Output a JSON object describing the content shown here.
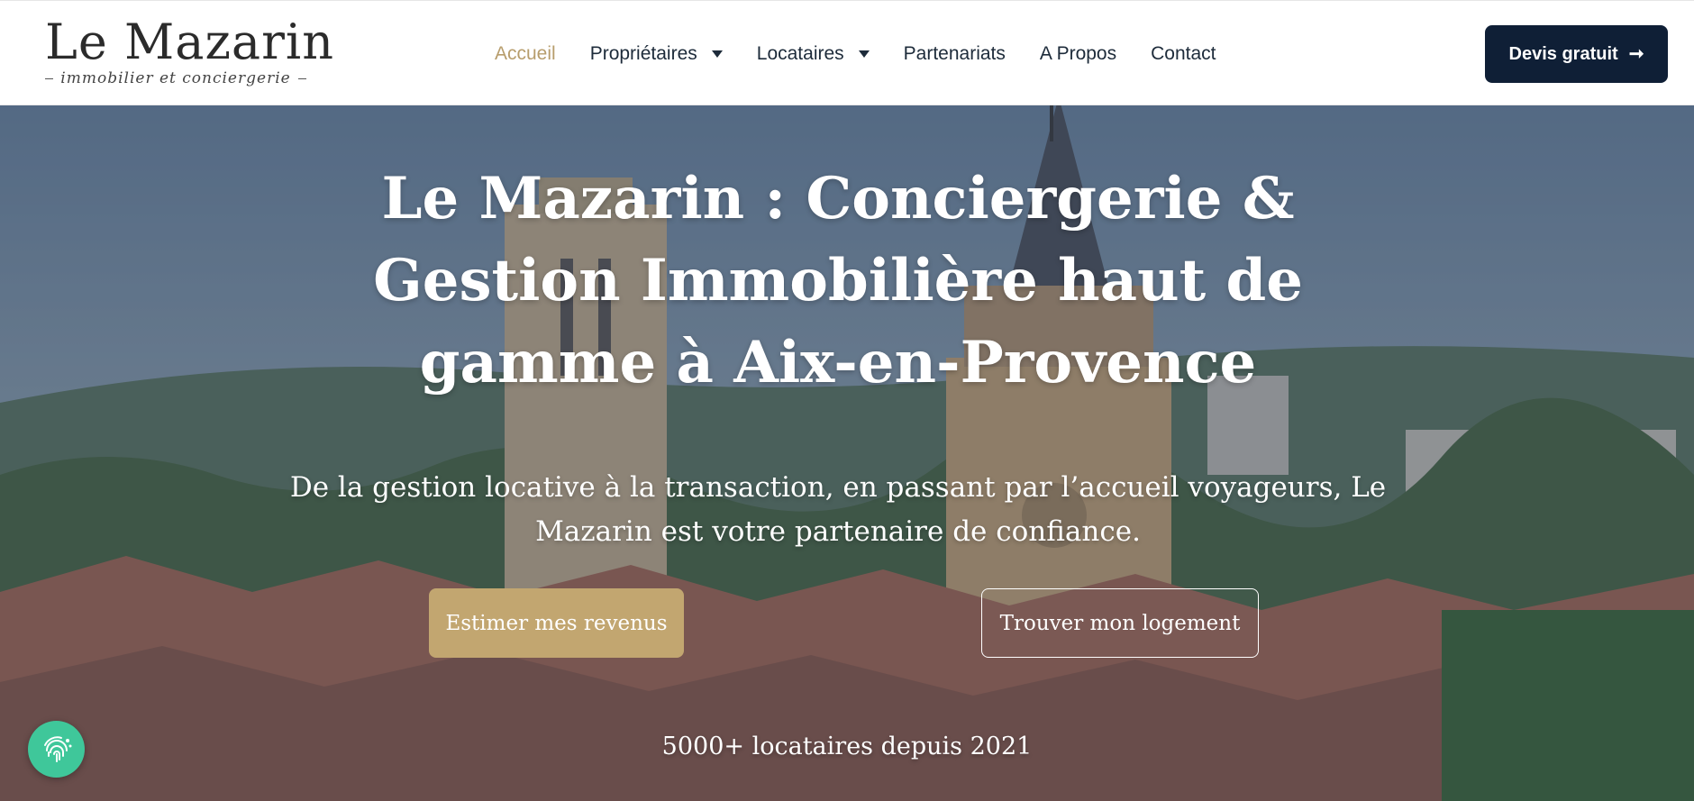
{
  "logo": {
    "name": "Le Mazarin",
    "tagline": "immobilier et conciergerie"
  },
  "nav": {
    "items": [
      {
        "label": "Accueil",
        "active": true,
        "dropdown": false
      },
      {
        "label": "Propriétaires",
        "active": false,
        "dropdown": true
      },
      {
        "label": "Locataires",
        "active": false,
        "dropdown": true
      },
      {
        "label": "Partenariats",
        "active": false,
        "dropdown": false
      },
      {
        "label": "A Propos",
        "active": false,
        "dropdown": false
      },
      {
        "label": "Contact",
        "active": false,
        "dropdown": false
      }
    ]
  },
  "header": {
    "cta_label": "Devis gratuit",
    "cta_icon": "arrow-right-icon"
  },
  "hero": {
    "title": "Le Mazarin : Conciergerie & Gestion Immobilière haut de gamme à Aix-en-Provence",
    "subtitle": "De la gestion locative à la transaction, en passant par l’accueil voyageurs, Le Mazarin est votre partenaire de confiance.",
    "primary_button": "Estimer mes revenus",
    "secondary_button": "Trouver mon logement",
    "stat": "5000+ locataires depuis 2021",
    "background_description_icon": "aix-en-provence-rooftops-photo"
  },
  "widget": {
    "icon": "fingerprint-icon"
  },
  "colors": {
    "accent_gold": "#c2a670",
    "nav_active": "#b79d6c",
    "navy": "#0f1f36",
    "widget_green": "#3fc79a"
  }
}
